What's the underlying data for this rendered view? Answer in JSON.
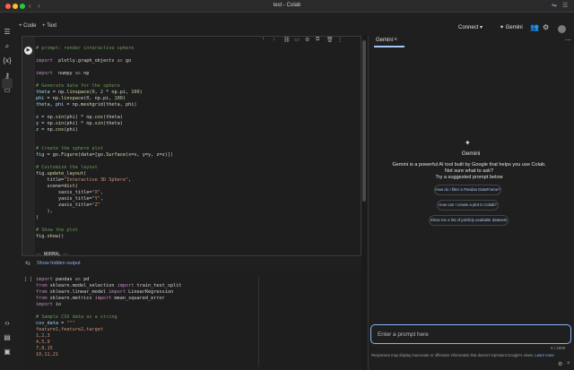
{
  "window": {
    "title": "test - Colab"
  },
  "toolbar": {
    "code_label": "Code",
    "text_label": "Text",
    "connect_label": "Connect",
    "gemini_label": "Gemini"
  },
  "cell1": {
    "lines": [
      [
        [
          "c-cm",
          "# prompt: render interactive sphere"
        ]
      ],
      [],
      [
        [
          "c-kw",
          "import"
        ],
        [
          "",
          "  plotly.graph_objects "
        ],
        [
          "c-kw",
          "as"
        ],
        [
          "",
          " go"
        ]
      ],
      [],
      [
        [
          "c-kw",
          "import"
        ],
        [
          "",
          "  numpy "
        ],
        [
          "c-kw",
          "as"
        ],
        [
          "",
          " np"
        ]
      ],
      [],
      [
        [
          "c-cm",
          "# Generate data for the sphere"
        ]
      ],
      [
        [
          "c-var",
          "theta"
        ],
        [
          "",
          " = np."
        ],
        [
          "c-fn",
          "linspace"
        ],
        [
          "",
          "("
        ],
        [
          "c-num",
          "0"
        ],
        [
          "",
          ", "
        ],
        [
          "c-num",
          "2"
        ],
        [
          "",
          " * np.pi, "
        ],
        [
          "c-num",
          "100"
        ],
        [
          "",
          ")"
        ]
      ],
      [
        [
          "c-var",
          "phi"
        ],
        [
          "",
          " = np."
        ],
        [
          "c-fn",
          "linspace"
        ],
        [
          "",
          "("
        ],
        [
          "c-num",
          "0"
        ],
        [
          "",
          ", np.pi, "
        ],
        [
          "c-num",
          "100"
        ],
        [
          "",
          ")"
        ]
      ],
      [
        [
          "c-var",
          "theta"
        ],
        [
          "",
          ", "
        ],
        [
          "c-var",
          "phi"
        ],
        [
          "",
          " = np."
        ],
        [
          "c-fn",
          "meshgrid"
        ],
        [
          "",
          "(theta, phi)"
        ]
      ],
      [],
      [
        [
          "c-var",
          "x"
        ],
        [
          "",
          " = np."
        ],
        [
          "c-fn",
          "sin"
        ],
        [
          "",
          "(phi) * np."
        ],
        [
          "c-fn",
          "cos"
        ],
        [
          "",
          "(theta)"
        ]
      ],
      [
        [
          "c-var",
          "y"
        ],
        [
          "",
          " = np."
        ],
        [
          "c-fn",
          "sin"
        ],
        [
          "",
          "(phi) * np."
        ],
        [
          "c-fn",
          "sin"
        ],
        [
          "",
          "(theta)"
        ]
      ],
      [
        [
          "c-var",
          "z"
        ],
        [
          "",
          " = np."
        ],
        [
          "c-fn",
          "cos"
        ],
        [
          "",
          "(phi)"
        ]
      ],
      [],
      [],
      [
        [
          "c-cm",
          "# Create the sphere plot"
        ]
      ],
      [
        [
          "c-var",
          "fig"
        ],
        [
          "",
          " = go."
        ],
        [
          "c-fn",
          "Figure"
        ],
        [
          "",
          "(data=[go."
        ],
        [
          "c-fn",
          "Surface"
        ],
        [
          "",
          "(x=x, y=y, z=z)])"
        ]
      ],
      [],
      [
        [
          "c-cm",
          "# Customize the layout"
        ]
      ],
      [
        [
          "",
          "fig."
        ],
        [
          "c-fn",
          "update_layout"
        ],
        [
          "",
          "("
        ]
      ],
      [
        [
          "",
          "    title="
        ],
        [
          "c-str",
          "\"Interactive 3D Sphere\""
        ],
        [
          "",
          ","
        ]
      ],
      [
        [
          "",
          "    scene="
        ],
        [
          "c-fn",
          "dict"
        ],
        [
          "",
          "("
        ]
      ],
      [
        [
          "",
          "        xaxis_title="
        ],
        [
          "c-str",
          "\"X\""
        ],
        [
          "",
          ","
        ]
      ],
      [
        [
          "",
          "        yaxis_title="
        ],
        [
          "c-str",
          "\"Y\""
        ],
        [
          "",
          ","
        ]
      ],
      [
        [
          "",
          "        zaxis_title="
        ],
        [
          "c-str",
          "\"Z\""
        ]
      ],
      [
        [
          "",
          "    ),"
        ]
      ],
      [
        [
          "",
          ")"
        ]
      ],
      [],
      [
        [
          "c-cm",
          "# Show the plot"
        ]
      ],
      [
        [
          "",
          "fig."
        ],
        [
          "c-fn",
          "show"
        ],
        [
          "",
          "()"
        ]
      ]
    ],
    "mode_line": "-- NORMAL --"
  },
  "output": {
    "show_hidden_label": "Show hidden output"
  },
  "cell2": {
    "bracket": "[ ]",
    "lines": [
      [
        [
          "c-kw",
          "import"
        ],
        [
          "",
          " pandas "
        ],
        [
          "c-kw",
          "as"
        ],
        [
          "",
          " pd"
        ]
      ],
      [
        [
          "c-kw",
          "from"
        ],
        [
          "",
          " sklearn.model_selection "
        ],
        [
          "c-kw",
          "import"
        ],
        [
          "",
          " train_test_split"
        ]
      ],
      [
        [
          "c-kw",
          "from"
        ],
        [
          "",
          " sklearn.linear_model "
        ],
        [
          "c-kw",
          "import"
        ],
        [
          "",
          " LinearRegression"
        ]
      ],
      [
        [
          "c-kw",
          "from"
        ],
        [
          "",
          " sklearn.metrics "
        ],
        [
          "c-kw",
          "import"
        ],
        [
          "",
          " mean_squared_error"
        ]
      ],
      [
        [
          "c-kw",
          "import"
        ],
        [
          "",
          " io"
        ]
      ],
      [],
      [
        [
          "c-cm",
          "# Sample CSV data as a string"
        ]
      ],
      [
        [
          "c-var",
          "csv_data"
        ],
        [
          "",
          " = "
        ],
        [
          "c-str",
          "\"\"\""
        ]
      ],
      [
        [
          "c-str",
          "feature1,feature2,target"
        ]
      ],
      [
        [
          "c-str",
          "1,2,3"
        ]
      ],
      [
        [
          "c-str",
          "4,5,9"
        ]
      ],
      [
        [
          "c-str",
          "7,8,15"
        ]
      ],
      [
        [
          "c-str",
          "10,11,21"
        ]
      ]
    ]
  },
  "gemini": {
    "tab_label": "Gemini",
    "title": "Gemini",
    "desc1": "Gemini is a powerful AI tool built by Google that helps you use Colab.",
    "desc2": "Not sure what to ask?",
    "desc3": "Try a suggested prompt below",
    "suggestions": [
      "How do I filter a Pandas DataFrame?",
      "How can I create a plot in Colab?",
      "Show me a list of publicly available datasets"
    ],
    "prompt_placeholder": "Enter a prompt here",
    "counter": "0 / 2000",
    "disclaimer": "Responses may display inaccurate or offensive information that doesn't represent Google's views.",
    "learn_more": "Learn more"
  }
}
